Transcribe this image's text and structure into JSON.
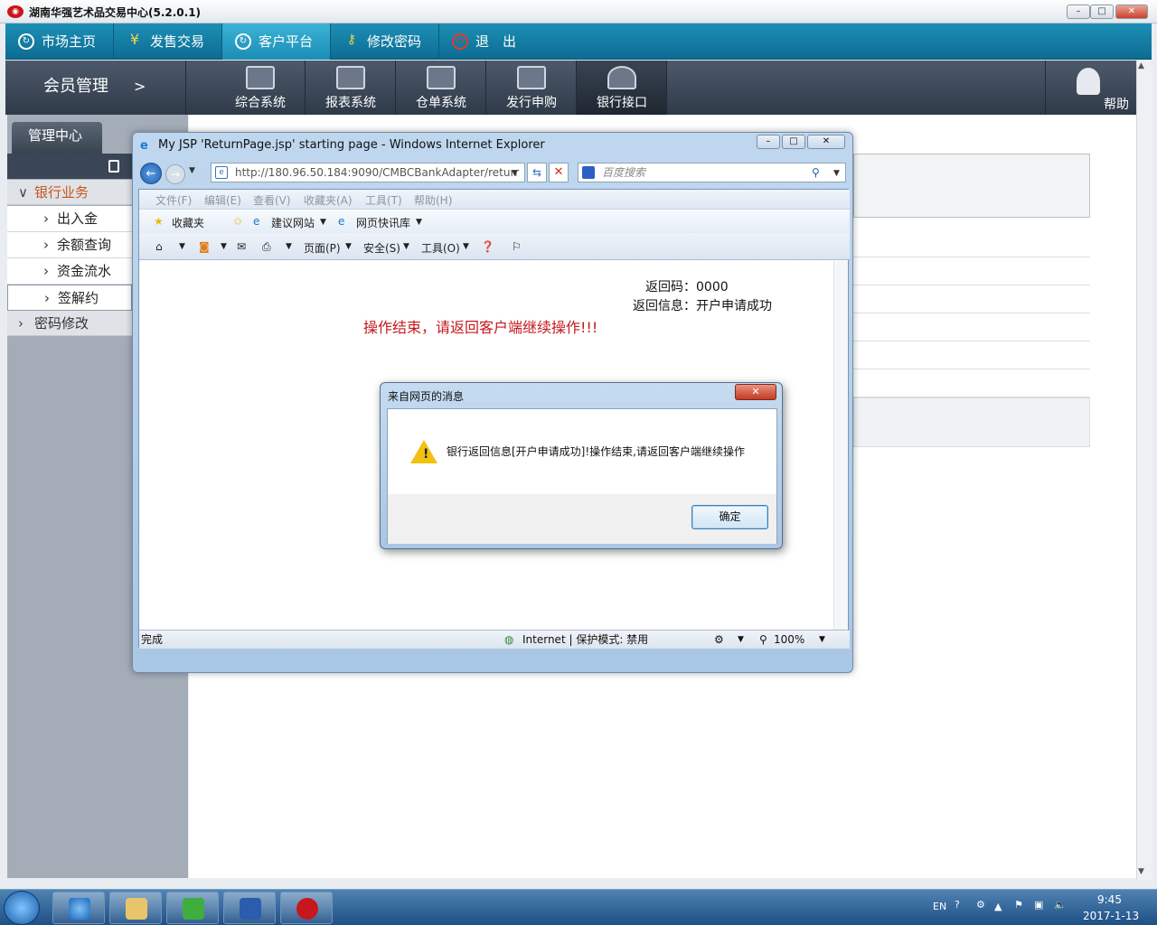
{
  "window": {
    "title": "湖南华强艺术品交易中心(5.2.0.1)",
    "controls": {
      "minimize": "–",
      "maximize": "□",
      "close": "✕"
    }
  },
  "main_nav": {
    "items": [
      {
        "label": "市场主页",
        "icon": "refresh-icon"
      },
      {
        "label": "发售交易",
        "icon": "yen-icon"
      },
      {
        "label": "客户平台",
        "icon": "refresh-icon",
        "active": true
      },
      {
        "label": "修改密码",
        "icon": "key-icon"
      },
      {
        "label": "退　出",
        "icon": "power-icon"
      }
    ]
  },
  "sub_nav": {
    "section": "会员管理",
    "arrow": ">",
    "items": [
      {
        "label": "综合系统"
      },
      {
        "label": "报表系统"
      },
      {
        "label": "仓单系统"
      },
      {
        "label": "发行申购"
      },
      {
        "label": "银行接口",
        "active": true
      }
    ],
    "help": "帮助"
  },
  "sidebar": {
    "tab": "管理中心",
    "groups": [
      {
        "label": "银行业务",
        "expanded": true,
        "items": [
          "出入金",
          "余额查询",
          "资金流水",
          "签解约"
        ],
        "active_item": "签解约"
      },
      {
        "label": "密码修改",
        "expanded": false
      }
    ]
  },
  "ie": {
    "title": "My JSP 'ReturnPage.jsp' starting page - Windows Internet Explorer",
    "address": "http://180.96.50.184:9090/CMBCBankAdapter/returr",
    "search_placeholder": "百度搜索",
    "menu": [
      "文件(F)",
      "编辑(E)",
      "查看(V)",
      "收藏夹(A)",
      "工具(T)",
      "帮助(H)"
    ],
    "favorites": {
      "label": "收藏夹",
      "suggested": "建议网站",
      "webslice": "网页快讯库"
    },
    "commands": {
      "page": "页面(P)",
      "safety": "安全(S)",
      "tools": "工具(O)"
    },
    "page": {
      "return_code_label": "返回码：0000",
      "return_msg_label": "返回信息：开户申请成功",
      "operation_msg": "操作结束，请返回客户端继续操作!!!"
    },
    "status": {
      "left": "完成",
      "zone": "Internet | 保护模式: 禁用",
      "zoom": "100%"
    }
  },
  "dialog": {
    "title": "来自网页的消息",
    "message": "银行返回信息[开户申请成功]!操作结束,请返回客户端继续操作",
    "ok": "确定",
    "close": "✕"
  },
  "taskbar": {
    "apps": [
      "ie-icon",
      "folder-icon",
      "network-icon",
      "word-icon",
      "trading-app-icon"
    ],
    "tray_lang": "EN",
    "time": "9:45",
    "date": "2017-1-13"
  },
  "colors": {
    "nav_blue": "#0c6c93",
    "sub_nav": "#2f3a49",
    "accent_orange": "#c9561a",
    "error_red": "#c4181d"
  }
}
